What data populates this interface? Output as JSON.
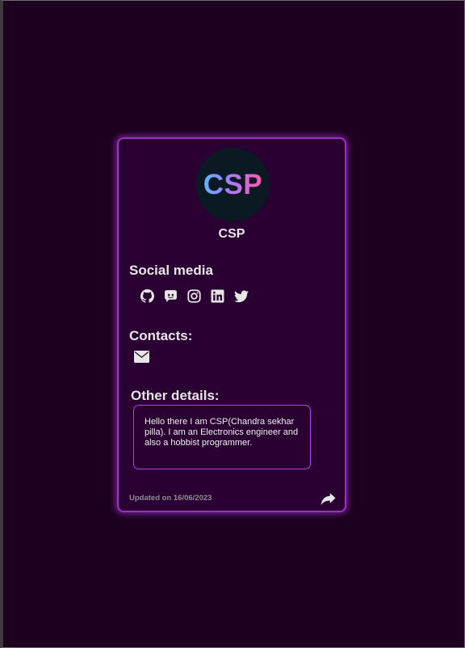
{
  "profile": {
    "avatar_text": "CSP",
    "name": "CSP"
  },
  "social": {
    "heading": "Social media",
    "icons": [
      "github-icon",
      "discord-icon",
      "instagram-icon",
      "linkedin-icon",
      "twitter-icon"
    ]
  },
  "contacts": {
    "heading": "Contacts:",
    "icons": [
      "mail-icon"
    ]
  },
  "other": {
    "heading": "Other details:",
    "text": "Hello there I am CSP(Chandra sekhar pilla). I am an Electronics engineer and also a hobbist programmer."
  },
  "footer": {
    "updated": "Updated on 16/06/2023",
    "share_icon": "share-icon"
  },
  "colors": {
    "background": "#1d0020",
    "card": "#2a0033",
    "accent": "#9b2fc9"
  }
}
